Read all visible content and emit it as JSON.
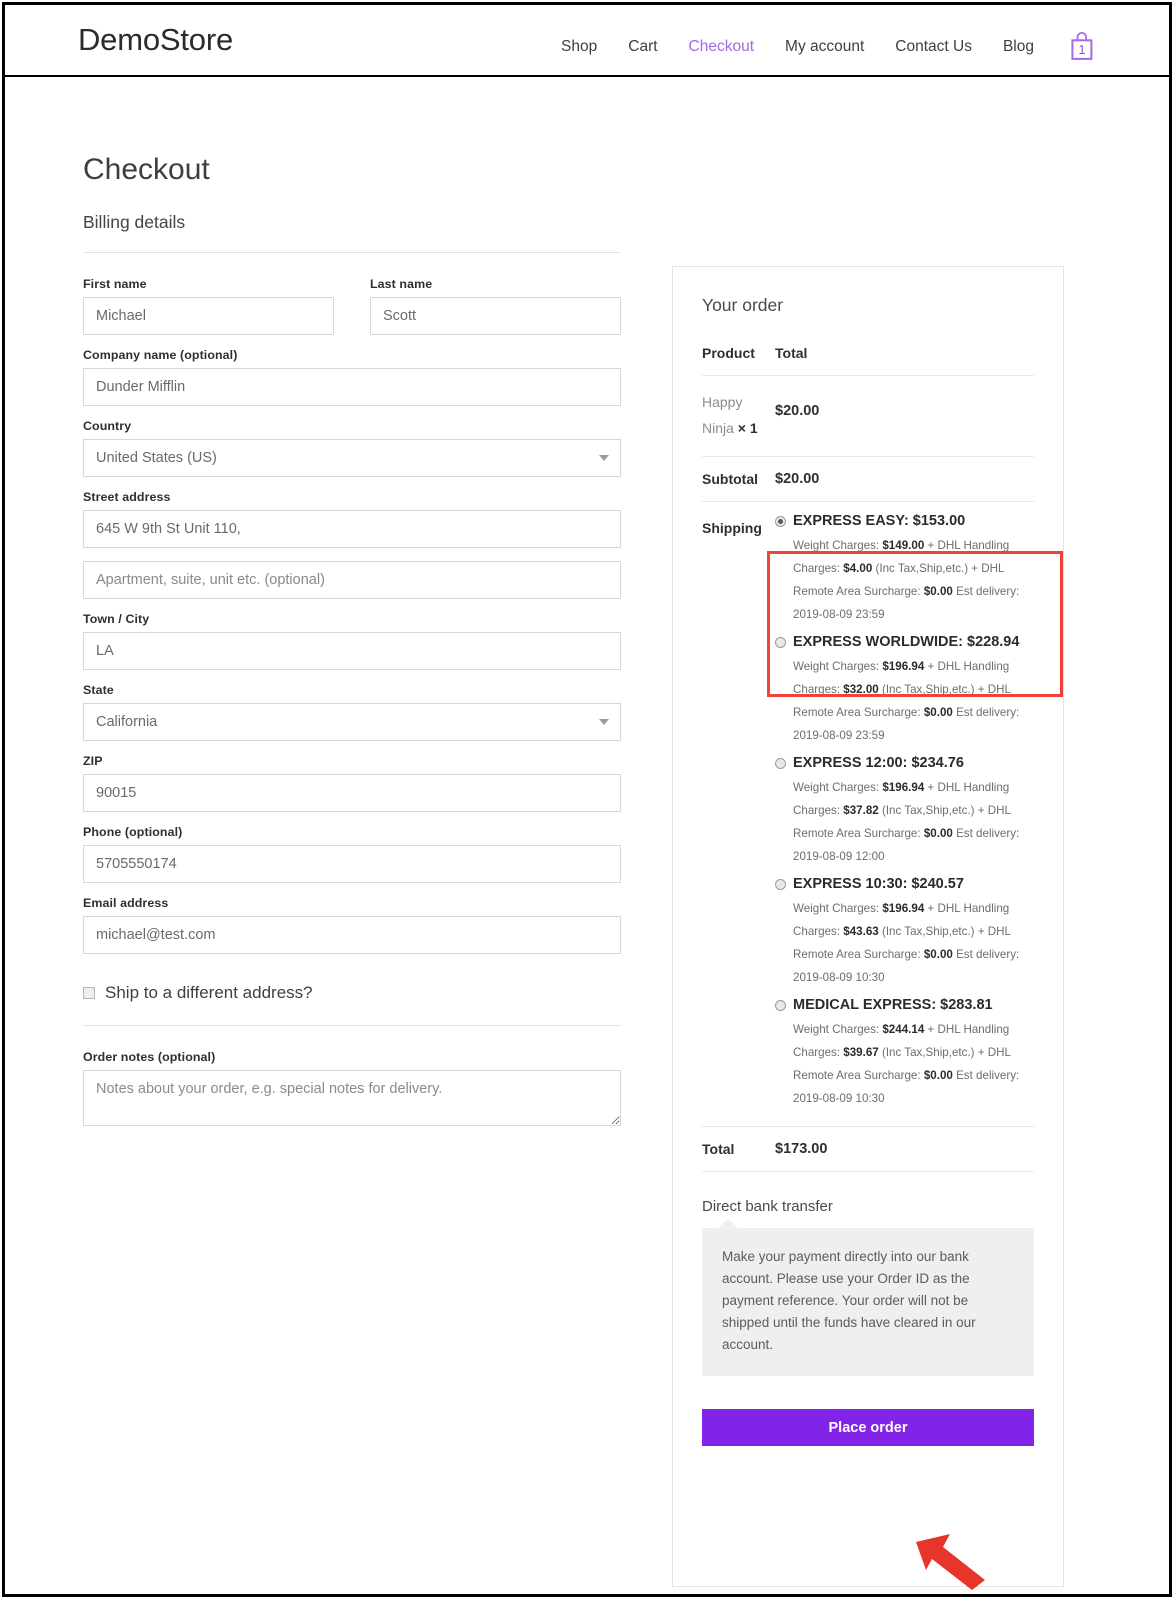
{
  "header": {
    "brand": "DemoStore",
    "nav": [
      {
        "label": "Shop",
        "active": false
      },
      {
        "label": "Cart",
        "active": false
      },
      {
        "label": "Checkout",
        "active": true
      },
      {
        "label": "My account",
        "active": false
      },
      {
        "label": "Contact Us",
        "active": false
      },
      {
        "label": "Blog",
        "active": false
      }
    ],
    "cart_count": "1",
    "accent_color": "#a569e8"
  },
  "page": {
    "title": "Checkout"
  },
  "billing": {
    "heading": "Billing details",
    "first_name": {
      "label": "First name",
      "value": "Michael"
    },
    "last_name": {
      "label": "Last name",
      "value": "Scott"
    },
    "company": {
      "label": "Company name (optional)",
      "value": "Dunder Mifflin"
    },
    "country": {
      "label": "Country",
      "value": "United States (US)"
    },
    "street_address": {
      "label": "Street address",
      "value": "645 W 9th St Unit 110,"
    },
    "address_2": {
      "label": "",
      "placeholder": "Apartment, suite, unit etc. (optional)",
      "value": ""
    },
    "city": {
      "label": "Town / City",
      "value": "LA"
    },
    "state": {
      "label": "State",
      "value": "California"
    },
    "zip": {
      "label": "ZIP",
      "value": "90015"
    },
    "phone": {
      "label": "Phone (optional)",
      "value": "5705550174"
    },
    "email": {
      "label": "Email address",
      "value": "michael@test.com"
    },
    "ship_different": {
      "label": "Ship to a different address?",
      "checked": false
    },
    "order_notes": {
      "label": "Order notes (optional)",
      "placeholder": "Notes about your order, e.g. special notes for delivery.",
      "value": ""
    }
  },
  "order": {
    "heading": "Your order",
    "col_product": "Product",
    "col_total": "Total",
    "items": [
      {
        "name": "Happy Ninja",
        "times": "×",
        "qty": "1",
        "total": "$20.00"
      }
    ],
    "subtotal_label": "Subtotal",
    "subtotal_value": "$20.00",
    "shipping_label": "Shipping",
    "shipping_methods": [
      {
        "title": "EXPRESS EASY: $153.00",
        "selected": true,
        "highlighted": true,
        "weight_prefix": "Weight Charges: ",
        "weight_value": "$149.00",
        "weight_suffix": " + DHL Handling",
        "handling_prefix": "Charges: ",
        "handling_value": "$4.00",
        "handling_suffix": " (Inc Tax,Ship,etc.) +  DHL",
        "surcharge_prefix": "Remote Area Surcharge: ",
        "surcharge_value": "$0.00",
        "est_delivery": "Est delivery: 2019-08-09 23:59"
      },
      {
        "title": "EXPRESS WORLDWIDE: $228.94",
        "selected": false,
        "highlighted": false,
        "weight_prefix": "Weight Charges: ",
        "weight_value": "$196.94",
        "weight_suffix": " + DHL Handling",
        "handling_prefix": "Charges: ",
        "handling_value": "$32.00",
        "handling_suffix": " (Inc Tax,Ship,etc.) +  DHL",
        "surcharge_prefix": "Remote Area Surcharge: ",
        "surcharge_value": "$0.00",
        "est_delivery": "Est delivery: 2019-08-09 23:59"
      },
      {
        "title": "EXPRESS 12:00: $234.76",
        "selected": false,
        "highlighted": false,
        "weight_prefix": "Weight Charges: ",
        "weight_value": "$196.94",
        "weight_suffix": " + DHL Handling",
        "handling_prefix": "Charges: ",
        "handling_value": "$37.82",
        "handling_suffix": " (Inc Tax,Ship,etc.) +  DHL",
        "surcharge_prefix": "Remote Area Surcharge: ",
        "surcharge_value": "$0.00",
        "est_delivery": "Est delivery: 2019-08-09 12:00"
      },
      {
        "title": "EXPRESS 10:30: $240.57",
        "selected": false,
        "highlighted": false,
        "weight_prefix": "Weight Charges: ",
        "weight_value": "$196.94",
        "weight_suffix": " + DHL Handling",
        "handling_prefix": "Charges: ",
        "handling_value": "$43.63",
        "handling_suffix": " (Inc Tax,Ship,etc.) +  DHL",
        "surcharge_prefix": "Remote Area Surcharge: ",
        "surcharge_value": "$0.00",
        "est_delivery": "Est delivery: 2019-08-09 10:30"
      },
      {
        "title": "MEDICAL EXPRESS: $283.81",
        "selected": false,
        "highlighted": false,
        "weight_prefix": "Weight Charges: ",
        "weight_value": "$244.14",
        "weight_suffix": " + DHL Handling",
        "handling_prefix": "Charges: ",
        "handling_value": "$39.67",
        "handling_suffix": " (Inc Tax,Ship,etc.) +  DHL",
        "surcharge_prefix": "Remote Area Surcharge: ",
        "surcharge_value": "$0.00",
        "est_delivery": "Est delivery: 2019-08-09 10:30"
      }
    ],
    "total_label": "Total",
    "total_value": "$173.00",
    "payment_method": "Direct bank transfer",
    "payment_description": "Make your payment directly into our bank account. Please use your Order ID as the payment reference. Your order will not be shipped until the funds have cleared in our account.",
    "place_order_label": "Place order",
    "button_color": "#8223e8",
    "highlight_color": "#f04236",
    "annotation_arrow_color": "#e8352a"
  }
}
